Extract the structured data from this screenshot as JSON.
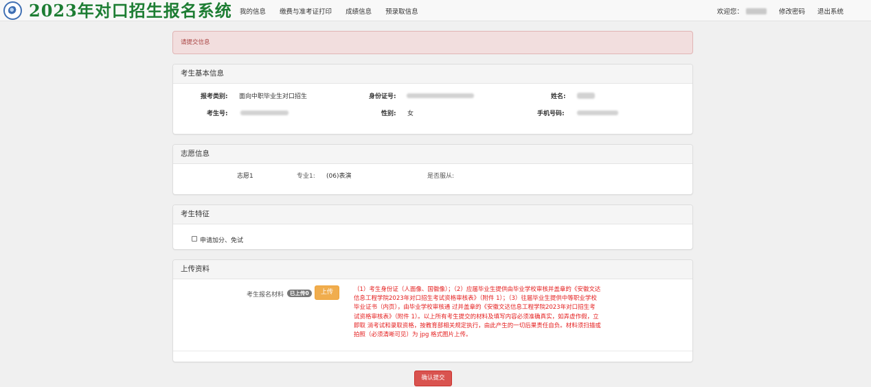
{
  "header": {
    "title": "2023年对口招生报名系统",
    "nav": [
      "我的信息",
      "缴费与准考证打印",
      "成绩信息",
      "预录取信息"
    ],
    "welcome": "欢迎您：",
    "change_password": "修改密码",
    "logout": "退出系统"
  },
  "alert": {
    "message": "请提交信息"
  },
  "basic_info": {
    "heading": "考生基本信息",
    "category_label": "报考类别:",
    "category_value": "面向中职毕业生对口招生",
    "id_label": "身份证号:",
    "name_label": "姓名:",
    "exam_no_label": "考生号:",
    "gender_label": "性别:",
    "gender_value": "女",
    "phone_label": "手机号码:"
  },
  "preference": {
    "heading": "志愿信息",
    "choice_label": "志愿1",
    "major_label": "专业1:",
    "major_value": "(06)表演",
    "obey_label": "是否服从:"
  },
  "features": {
    "heading": "考生特征",
    "checkbox_label": "申请加分、免试"
  },
  "upload": {
    "heading": "上传资料",
    "material_label": "考生报名材料",
    "uploaded_badge": "已上传0",
    "upload_button": "上传",
    "notice": "（1）考生身份证（人面像、国徽像）；（2）应届毕业生提供由毕业学校审核并盖章的《安徽文达信息工程学院2023年对口招生考试资格审核表》（附件 1）；（3）往届毕业生提供中等职业学校毕业证书（内页），由毕业学校审核通 过并盖章的《安徽文达信息工程学院2023年对口招生考试资格审核表》（附件 1）。以上所有考生提交的材料及填写内容必须准确真实，如弄虚作假，立即取 消考试和录取资格，按教育部相关规定执行，由此产生的一切后果责任自负。材料须扫描或拍照（必须清晰可见）为 jpg 格式图片上传。"
  },
  "submit_button": "确认提交"
}
